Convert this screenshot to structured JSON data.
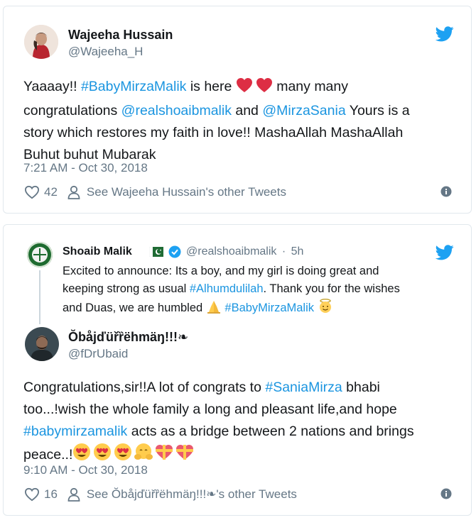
{
  "tweet1": {
    "name": "Wajeeha Hussain",
    "handle": "@Wajeeha_H",
    "text_parts": [
      {
        "t": "Yaaaay!! ",
        "link": false
      },
      {
        "t": "#BabyMirzaMalik",
        "link": true
      },
      {
        "t": " is here ",
        "link": false
      }
    ],
    "line1_after": " many many",
    "line2_pre": "congratulations ",
    "mention1": "@realshoaibmalik",
    "and": " and ",
    "mention2": "@MirzaSania",
    "line2_post": " Yours is a",
    "line3": "story which restores my faith in love!! MashaAllah MashaAllah",
    "line4": "Buhut buhut Mubarak",
    "timestamp": "7:21 AM - Oct 30, 2018",
    "likes": "42",
    "see_other": "See Wajeeha Hussain's other Tweets",
    "brand_color": "#1da1f2",
    "link_color": "#1b95e0"
  },
  "quoted": {
    "name": "Shoaib Malik",
    "handle": "@realshoaibmalik",
    "sep": "·",
    "time": "5h",
    "line1": "Excited to announce: Its a boy, and my girl is doing great and",
    "line2_pre": "keeping strong as usual ",
    "hashtag1": "#Alhumdulilah",
    "line2_post": ". Thank you for the wishes",
    "line3_pre": "and Duas, we are humbled ",
    "hashtag2": "#BabyMirzaMalik"
  },
  "tweet2": {
    "name": "Ŏbåjďüřȑëhmäŋ!!!❧",
    "handle": "@fDrUbaid",
    "line1_pre": "Congratulations,sir!!A lot of congrats to ",
    "hashtag1": "#SaniaMirza",
    "line1_post": " bhabi",
    "line2": "too...!wish the whole family a long and pleasant life,and hope",
    "hashtag2": "#babymirzamalik",
    "line3_post": " acts as a bridge between 2 nations and brings",
    "line4": "peace..!",
    "timestamp": "9:10 AM - Oct 30, 2018",
    "likes": "16",
    "see_other": "See Ŏbåjďüřȑëhmäŋ!!!❧'s other Tweets"
  }
}
